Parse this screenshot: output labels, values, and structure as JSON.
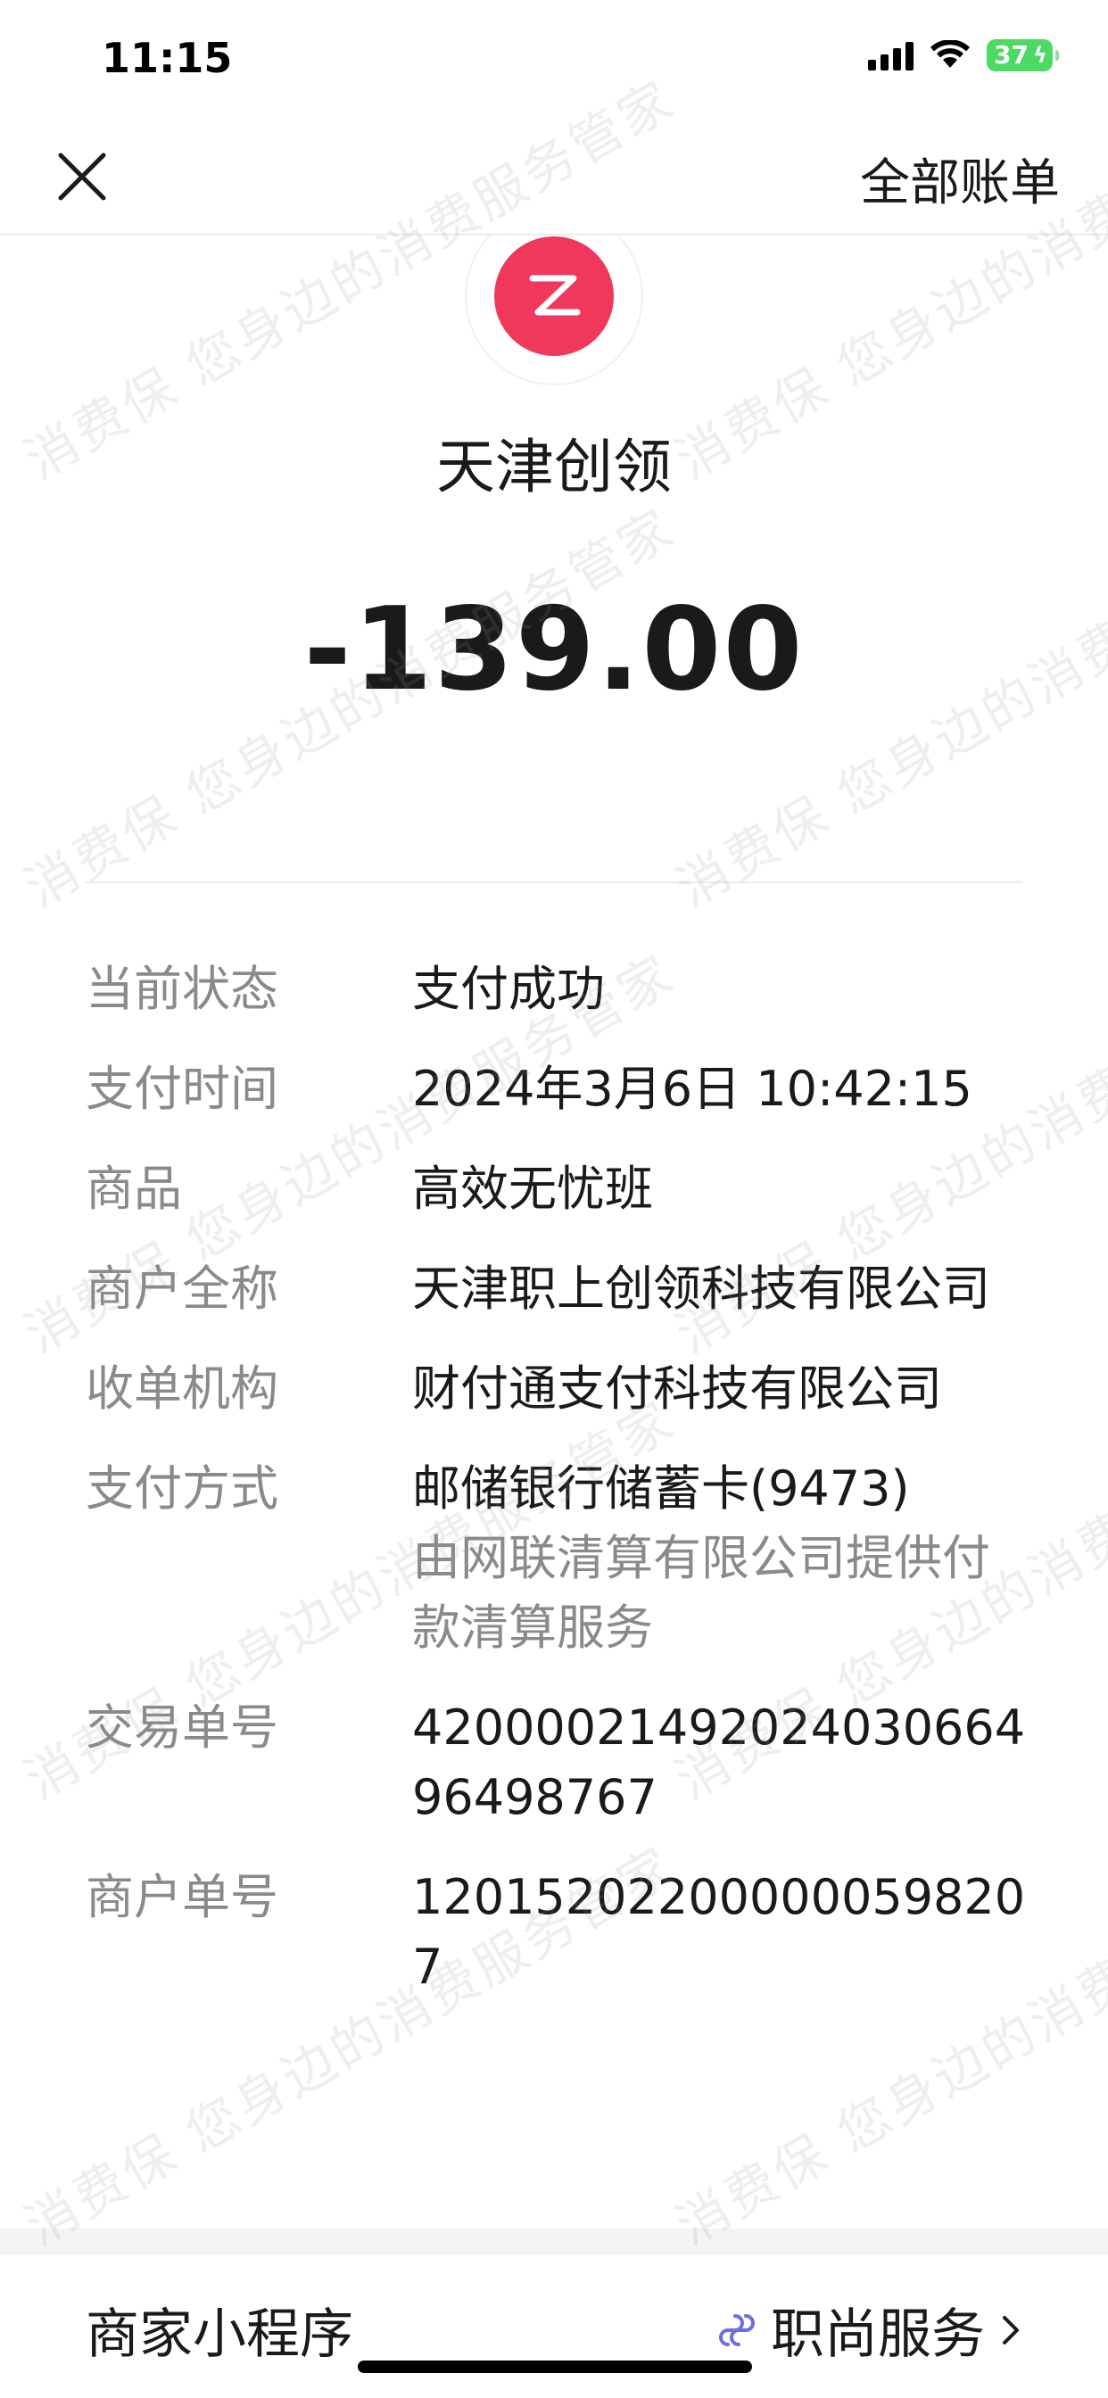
{
  "status_bar": {
    "time": "11:15",
    "battery": "37"
  },
  "nav": {
    "close_icon": "close-icon",
    "all_bills_label": "全部账单"
  },
  "header": {
    "logo_icon": "zhishang-z-logo",
    "logo_color": "#f0385c",
    "merchant_name": "天津创领",
    "amount": "-139.00"
  },
  "details": [
    {
      "label": "当前状态",
      "value": "支付成功"
    },
    {
      "label": "支付时间",
      "value": "2024年3月6日 10:42:15"
    },
    {
      "label": "商品",
      "value": "高效无忧班"
    },
    {
      "label": "商户全称",
      "value": "天津职上创领科技有限公司"
    },
    {
      "label": "收单机构",
      "value": "财付通支付科技有限公司"
    },
    {
      "label": "支付方式",
      "value": "邮储银行储蓄卡(9473)",
      "sub": "由网联清算有限公司提供付款清算服务"
    },
    {
      "label": "交易单号",
      "value": "4200002149202403066496498767"
    },
    {
      "label": "商户单号",
      "value": "12015202200000059820 7"
    }
  ],
  "mini_program": {
    "label": "商家小程序",
    "link_icon": "mini-program-link-icon",
    "link_label": "职尚服务",
    "chevron_icon": "chevron-right-icon"
  },
  "watermark": {
    "text": "消费保 您身边的消费服务管家"
  }
}
